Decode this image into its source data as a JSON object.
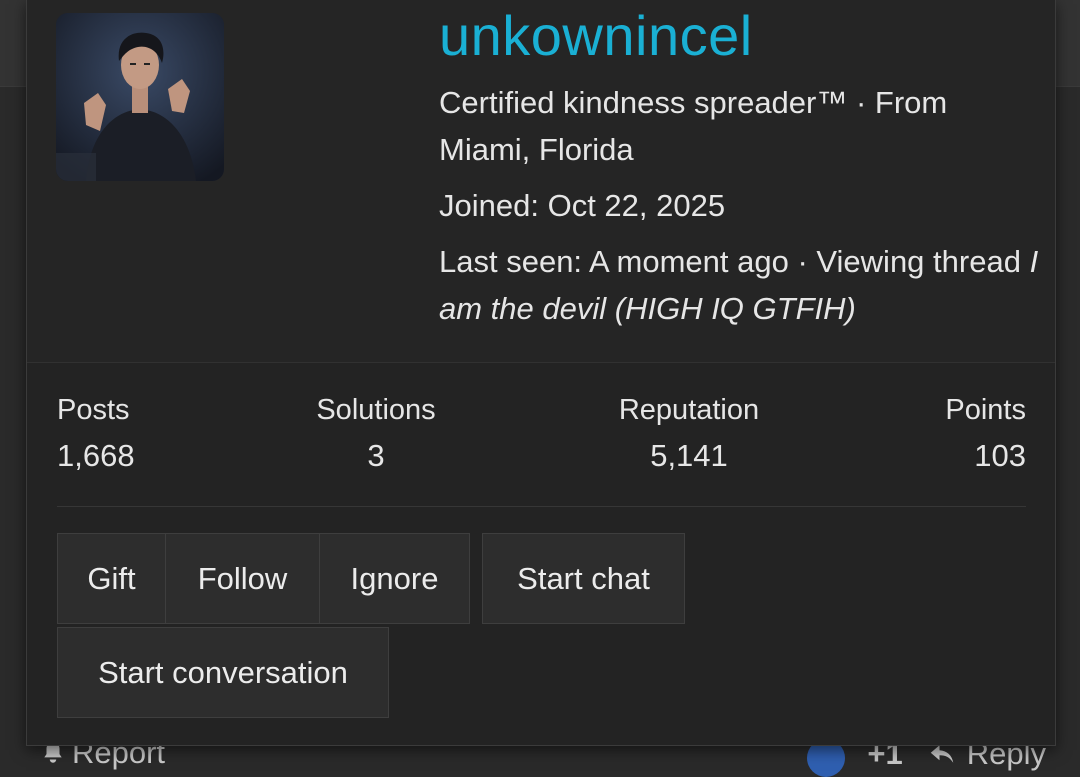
{
  "member_card": {
    "username": "unkownincel",
    "blurb_title": "Certified kindness spreader™",
    "location_prefix": "· From",
    "location": "Miami, Florida",
    "joined_label": "Joined:",
    "joined_date": "Oct 22, 2025",
    "last_seen_label": "Last seen:",
    "last_seen_value": "A moment ago",
    "activity_prefix": "· Viewing thread",
    "activity_thread": "I am the devil (HIGH IQ GTFIH)",
    "stats": [
      {
        "label": "Posts",
        "value": "1,668"
      },
      {
        "label": "Solutions",
        "value": "3"
      },
      {
        "label": "Reputation",
        "value": "5,141"
      },
      {
        "label": "Points",
        "value": "103"
      }
    ],
    "actions": {
      "gift": "Gift",
      "follow": "Follow",
      "ignore": "Ignore",
      "start_chat": "Start chat",
      "start_conversation": "Start conversation"
    }
  },
  "post_footer": {
    "report": "Report",
    "reaction_count": "+1",
    "reply": "Reply"
  },
  "colors": {
    "username": "#1ab0d4",
    "card_bg": "#232323",
    "page_bg": "#2a2a2a"
  }
}
